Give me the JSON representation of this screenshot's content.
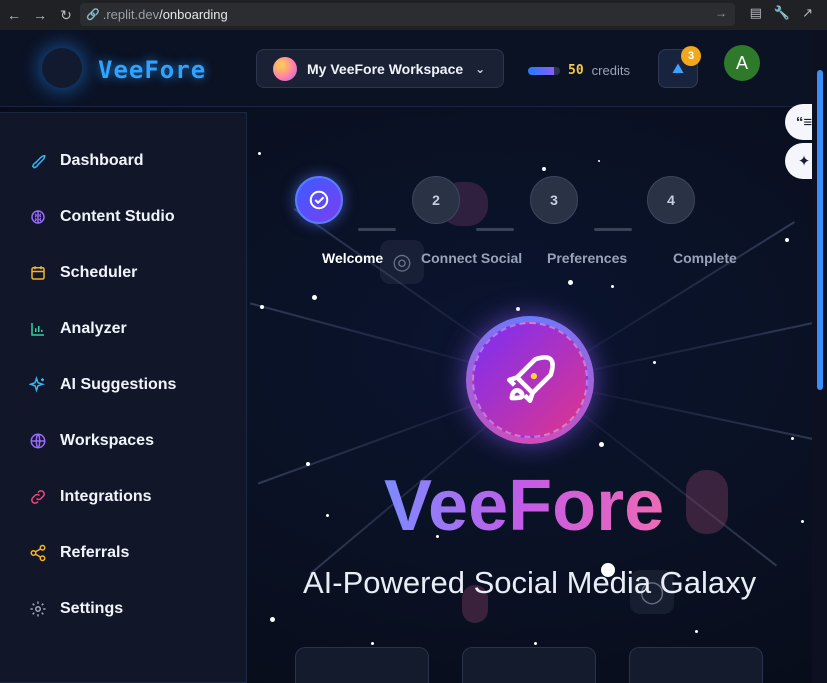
{
  "browser": {
    "url_host": ".replit.dev",
    "url_path": "/onboarding"
  },
  "topbar": {
    "brand": "VeeFore",
    "workspace_label": "My VeeFore Workspace",
    "credits_value": "50",
    "credits_label": "credits",
    "credits_fill_percent": 80,
    "notification_count": "3",
    "user_initial": "A"
  },
  "sidebar": {
    "items": [
      {
        "label": "Dashboard",
        "icon": "rocket-icon",
        "color": "#35b6f5"
      },
      {
        "label": "Content Studio",
        "icon": "brain-icon",
        "color": "#9a6bff"
      },
      {
        "label": "Scheduler",
        "icon": "calendar-icon",
        "color": "#f5b528"
      },
      {
        "label": "Analyzer",
        "icon": "bar-chart-icon",
        "color": "#2dd4a4"
      },
      {
        "label": "AI Suggestions",
        "icon": "sparkles-icon",
        "color": "#35b6f5"
      },
      {
        "label": "Workspaces",
        "icon": "globe-icon",
        "color": "#9a6bff"
      },
      {
        "label": "Integrations",
        "icon": "link-icon",
        "color": "#f0477f"
      },
      {
        "label": "Referrals",
        "icon": "share-icon",
        "color": "#f5b528"
      },
      {
        "label": "Settings",
        "icon": "gear-icon",
        "color": "#a0a8b8"
      }
    ]
  },
  "onboarding": {
    "steps": [
      {
        "number": "✓",
        "label": "Welcome"
      },
      {
        "number": "2",
        "label": "Connect Social"
      },
      {
        "number": "3",
        "label": "Preferences"
      },
      {
        "number": "4",
        "label": "Complete"
      }
    ],
    "title": "VeeFore",
    "subtitle": "AI-Powered Social Media Galaxy"
  }
}
